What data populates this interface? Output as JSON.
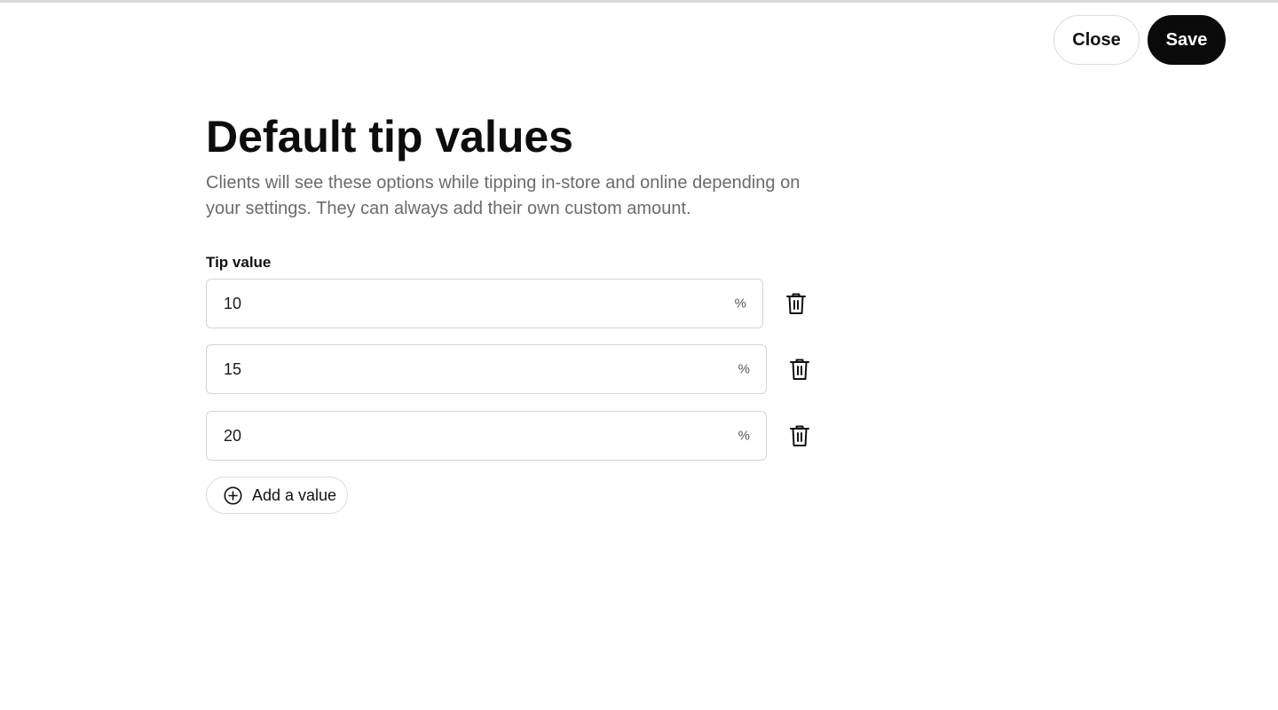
{
  "header": {
    "close_label": "Close",
    "save_label": "Save"
  },
  "page": {
    "title": "Default tip values",
    "description": "Clients will see these options while tipping in-store and online depending on your settings. They can always add their own custom amount."
  },
  "tip_values": {
    "label": "Tip value",
    "items": [
      {
        "value": "10",
        "suffix": "%"
      },
      {
        "value": "15",
        "suffix": "%"
      },
      {
        "value": "20",
        "suffix": "%"
      }
    ],
    "delete_icon": "trash-icon"
  },
  "add_value": {
    "label": "Add a value",
    "icon": "plus-circle-icon"
  },
  "colors": {
    "primary_button_bg": "#0a0a0a",
    "primary_button_text": "#ffffff",
    "description_text": "#6b6b6b",
    "border": "#d4d4d4"
  }
}
